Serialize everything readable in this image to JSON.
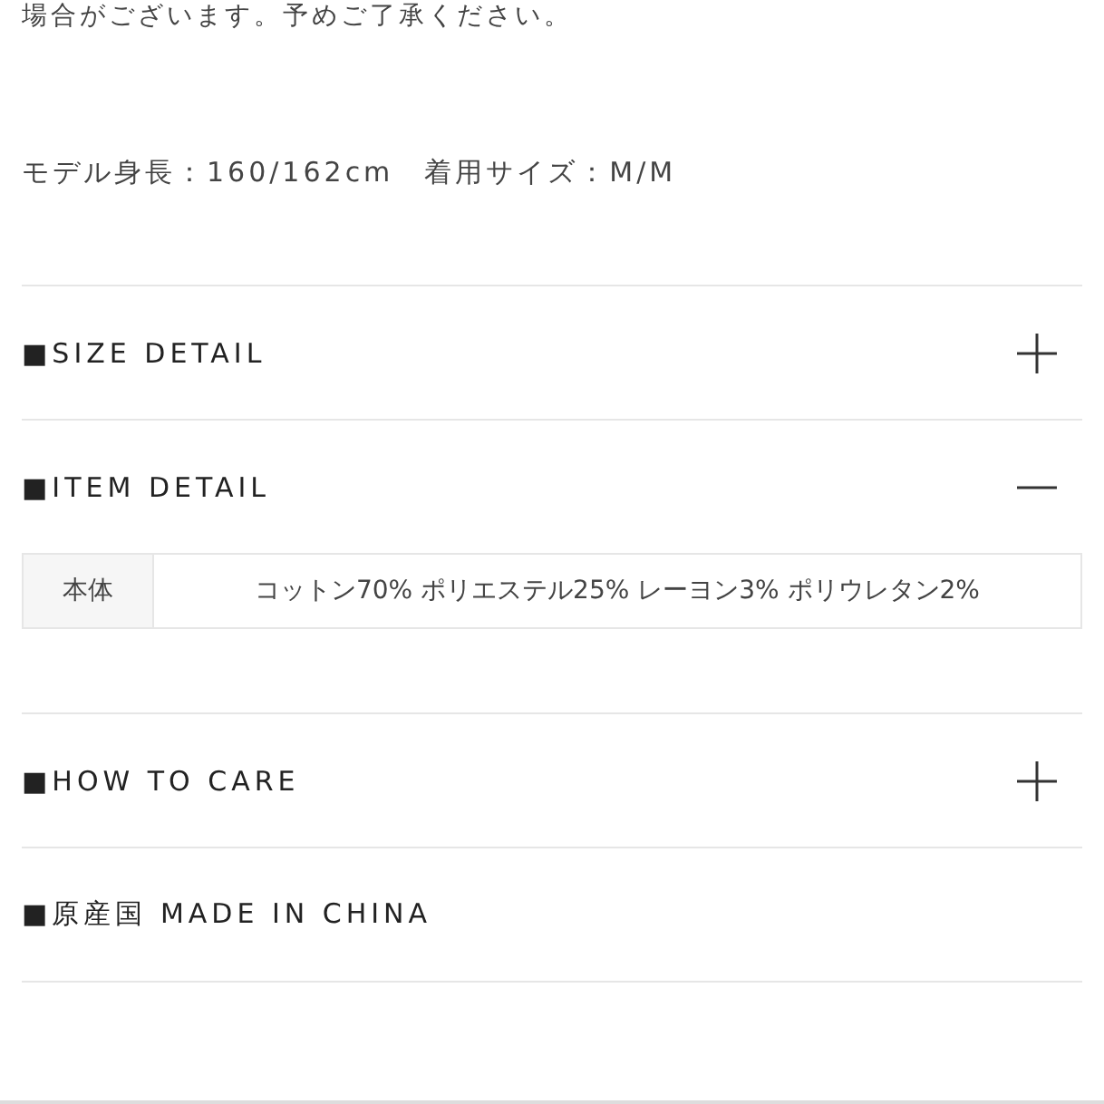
{
  "notice": "場合がございます。予めご了承ください。",
  "model_info": "モデル身長：160/162cm　着用サイズ：M/M",
  "sections": [
    {
      "kind": "accordion",
      "title": "■SIZE DETAIL",
      "expanded": false
    },
    {
      "kind": "accordion",
      "title": "■ITEM DETAIL",
      "expanded": true,
      "table": [
        {
          "label": "本体",
          "value": "コットン70% ポリエステル25% レーヨン3% ポリウレタン2%"
        }
      ]
    },
    {
      "kind": "accordion",
      "title": "■HOW TO CARE",
      "expanded": false
    },
    {
      "kind": "info",
      "title": "■原産国 MADE IN CHINA"
    }
  ]
}
